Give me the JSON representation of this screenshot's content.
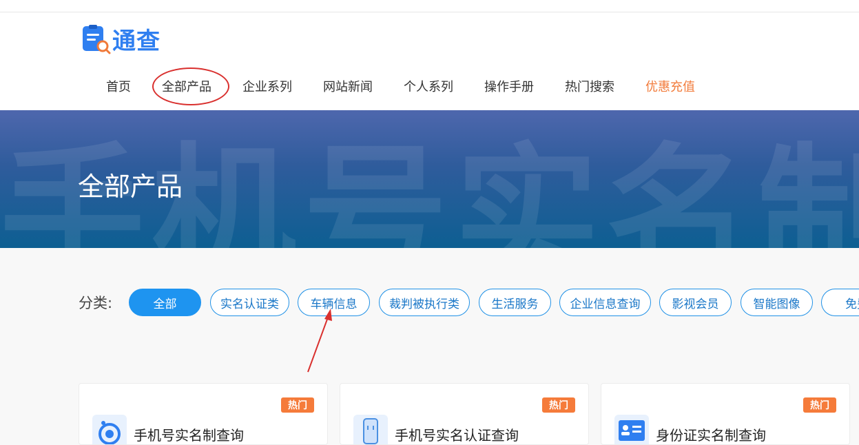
{
  "brand": {
    "name": "通查"
  },
  "nav": {
    "items": [
      {
        "label": "首页"
      },
      {
        "label": "全部产品"
      },
      {
        "label": "企业系列"
      },
      {
        "label": "网站新闻"
      },
      {
        "label": "个人系列"
      },
      {
        "label": "操作手册"
      },
      {
        "label": "热门搜索"
      },
      {
        "label": "优惠充值"
      }
    ],
    "promo_color": "#f27c3c"
  },
  "banner": {
    "title": "全部产品",
    "watermark": "手机号实名制"
  },
  "filter": {
    "label": "分类:",
    "chips": [
      {
        "label": "全部",
        "active": true
      },
      {
        "label": "实名认证类"
      },
      {
        "label": "车辆信息"
      },
      {
        "label": "裁判被执行类"
      },
      {
        "label": "生活服务"
      },
      {
        "label": "企业信息查询"
      },
      {
        "label": "影视会员"
      },
      {
        "label": "智能图像"
      },
      {
        "label": "免费"
      }
    ]
  },
  "products": [
    {
      "badge": "热门",
      "title": "手机号实名制查询",
      "icon": "phone-realname-icon"
    },
    {
      "badge": "热门",
      "title": "手机号实名认证查询",
      "icon": "phone-verify-icon"
    },
    {
      "badge": "热门",
      "title": "身份证实名制查询",
      "icon": "id-card-icon"
    }
  ],
  "colors": {
    "accent": "#1e94f0",
    "brand": "#2f7ff0",
    "hot": "#f57b3a",
    "annotation": "#d9302e"
  }
}
